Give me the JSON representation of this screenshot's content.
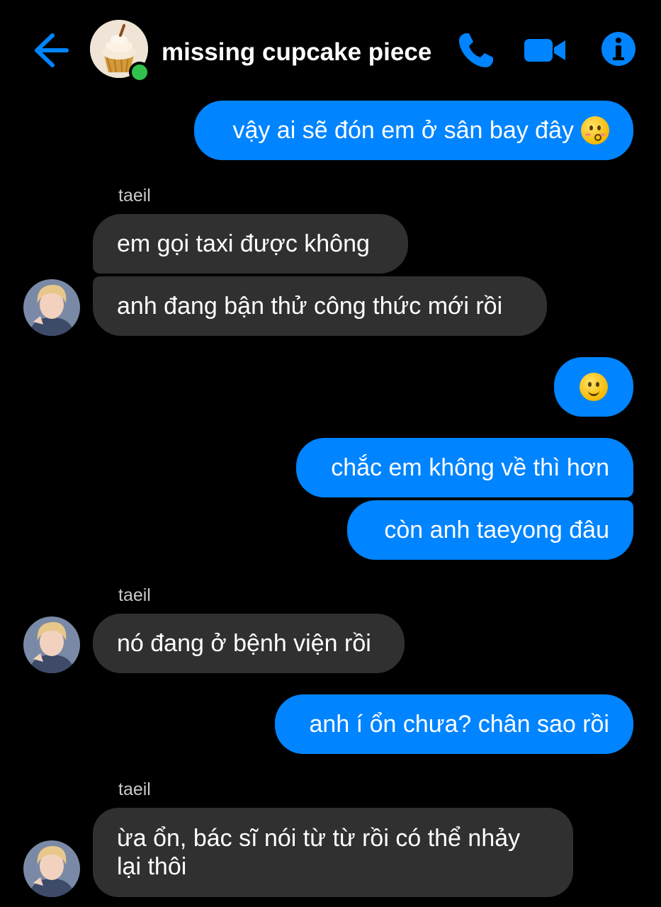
{
  "header": {
    "title": "missing cupcake piece",
    "online_status_color": "#31c24d",
    "icons": [
      "arrow-left-icon",
      "phone-icon",
      "video-camera-icon",
      "info-icon"
    ]
  },
  "colors": {
    "accent": "#0084ff",
    "incoming_bubble": "#303030",
    "background": "#000000"
  },
  "messages": [
    {
      "direction": "out",
      "text": "vậy ai sẽ đón em ở sân bay đây",
      "emoji": "kissing-face-emoji"
    },
    {
      "direction": "in",
      "sender": "taeil",
      "text": "em gọi taxi được không"
    },
    {
      "direction": "in",
      "text": "anh đang bận thử công thức mới rồi"
    },
    {
      "direction": "out",
      "text": "",
      "emoji": "slightly-smiling-face-emoji"
    },
    {
      "direction": "out",
      "text": "chắc em không về thì hơn"
    },
    {
      "direction": "out",
      "text": "còn anh taeyong đâu"
    },
    {
      "direction": "in",
      "sender": "taeil",
      "text": "nó đang ở bệnh viện rồi"
    },
    {
      "direction": "out",
      "text": "anh í ổn chưa? chân sao rồi"
    },
    {
      "direction": "in",
      "sender": "taeil",
      "text_line1": "ừa ổn, bác sĩ nói từ từ rồi có thể nhảy",
      "text_line2": "lại thôi"
    }
  ]
}
